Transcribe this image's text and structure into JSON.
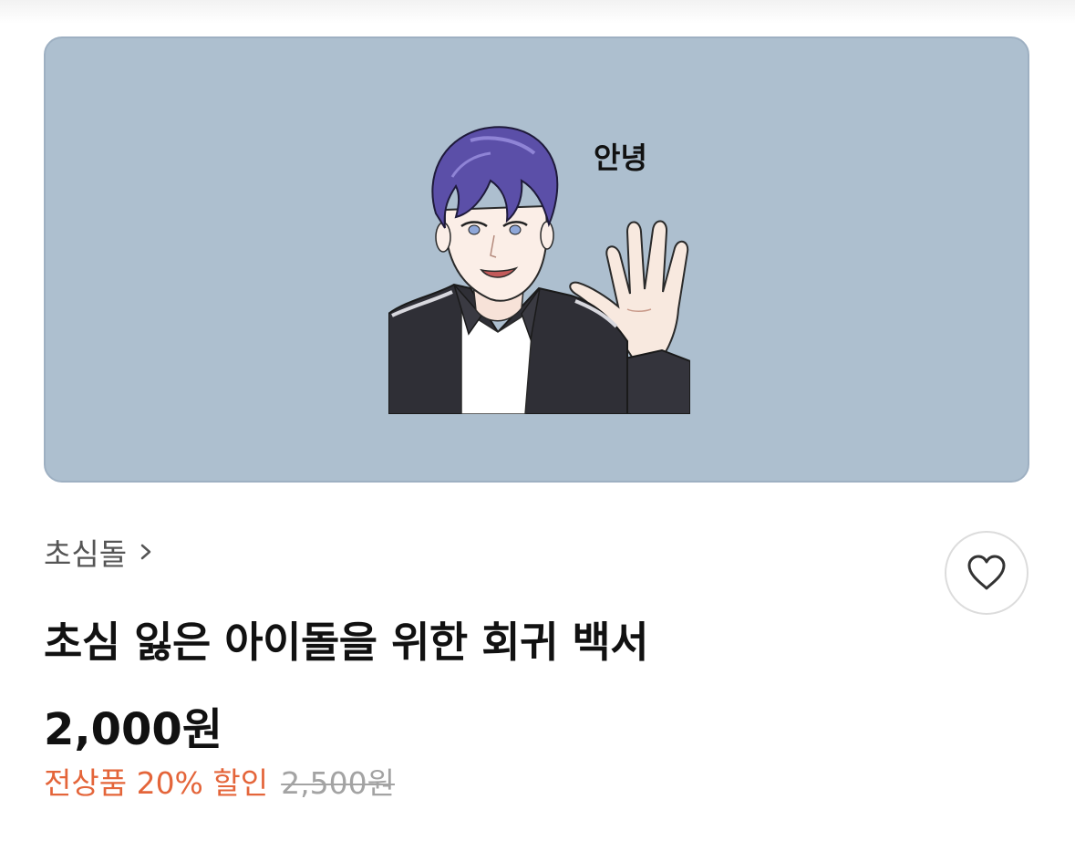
{
  "banner": {
    "background_color": "#adbfcf",
    "sticker_text": "안녕"
  },
  "series": {
    "name": "초심돌"
  },
  "product": {
    "title": "초심 잃은 아이돌을 위한 회귀 백서",
    "price": "2,000원",
    "discount_text": "전상품 20% 할인",
    "original_price": "2,500원",
    "discount_color": "#e4653a"
  },
  "icons": {
    "series_chevron": "chevron-right-icon",
    "like": "heart-outline-icon"
  }
}
